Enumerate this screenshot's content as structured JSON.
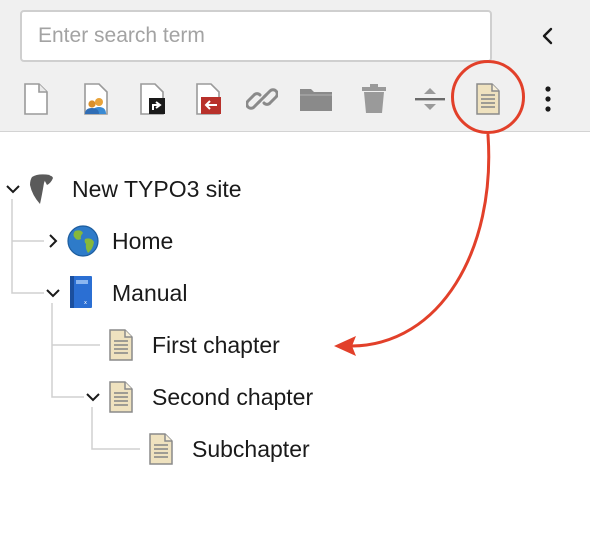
{
  "search": {
    "placeholder": "Enter search term",
    "value": ""
  },
  "toolbar": {
    "collapse": {
      "icon": "chevron-left-icon"
    },
    "buttons": [
      {
        "icon": "new-page-icon"
      },
      {
        "icon": "page-with-users-icon"
      },
      {
        "icon": "page-shortcut-icon"
      },
      {
        "icon": "page-external-link-icon"
      },
      {
        "icon": "link-icon"
      },
      {
        "icon": "folder-icon"
      },
      {
        "icon": "trash-icon"
      },
      {
        "icon": "divider-icon"
      },
      {
        "icon": "standard-page-icon"
      },
      {
        "icon": "more-vertical-icon"
      }
    ],
    "highlight_color": "#e2402a"
  },
  "tree": {
    "root": {
      "label": "New TYPO3 site",
      "icon": "typo3-logo-icon",
      "expanded": true
    },
    "nodes": [
      {
        "label": "Home",
        "icon": "globe-icon",
        "expanded": false
      },
      {
        "label": "Manual",
        "icon": "book-icon",
        "expanded": true
      },
      {
        "label": "First chapter",
        "icon": "page-icon"
      },
      {
        "label": "Second chapter",
        "icon": "page-icon",
        "expanded": true
      },
      {
        "label": "Subchapter",
        "icon": "page-icon"
      }
    ]
  },
  "colors": {
    "annotation": "#e2402a",
    "toolbar_bg": "#f0f0f0",
    "tree_lines": "#d0d0d0"
  }
}
